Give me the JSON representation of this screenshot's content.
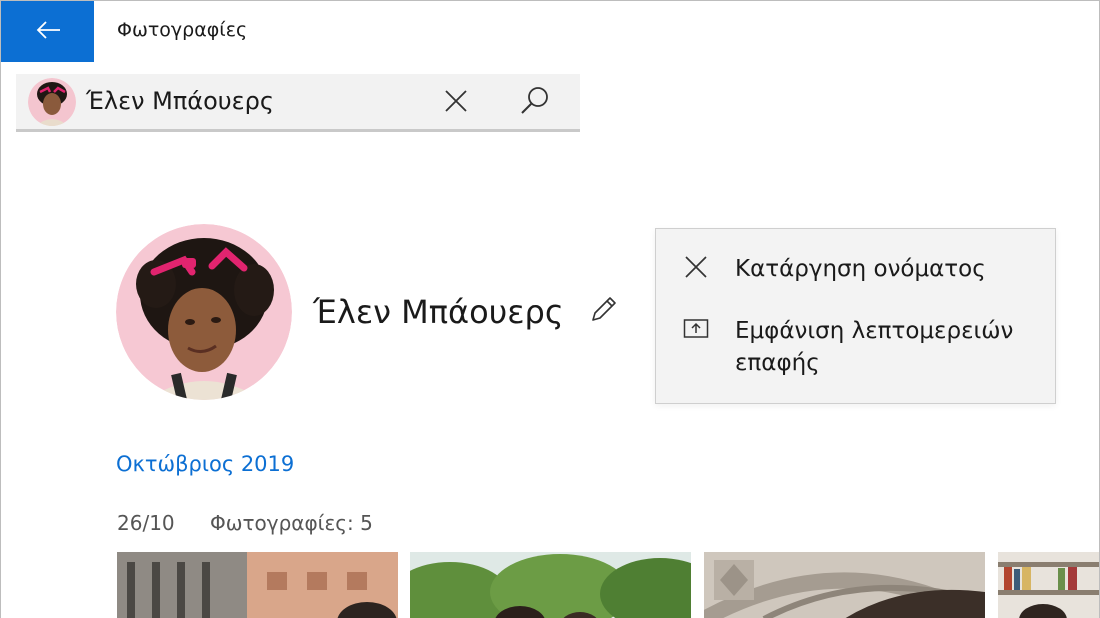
{
  "header": {
    "app_title": "Φωτογραφίες"
  },
  "search": {
    "query": "Έλεν Μπάουερς"
  },
  "person": {
    "name": "Έλεν Μπάουερς"
  },
  "context_menu": {
    "items": [
      {
        "label": "Κατάργηση ονόματος",
        "icon": "close-icon"
      },
      {
        "label": "Εμφάνιση λεπτομερειών επαφής",
        "icon": "contact-card-icon"
      }
    ]
  },
  "timeline": {
    "month": "Οκτώβριος 2019",
    "day": "26/10",
    "count": "Φωτογραφίες: 5"
  },
  "colors": {
    "accent": "#0c6fd3",
    "search_bg": "#f2f2f2",
    "menu_bg": "#f3f3f3"
  }
}
